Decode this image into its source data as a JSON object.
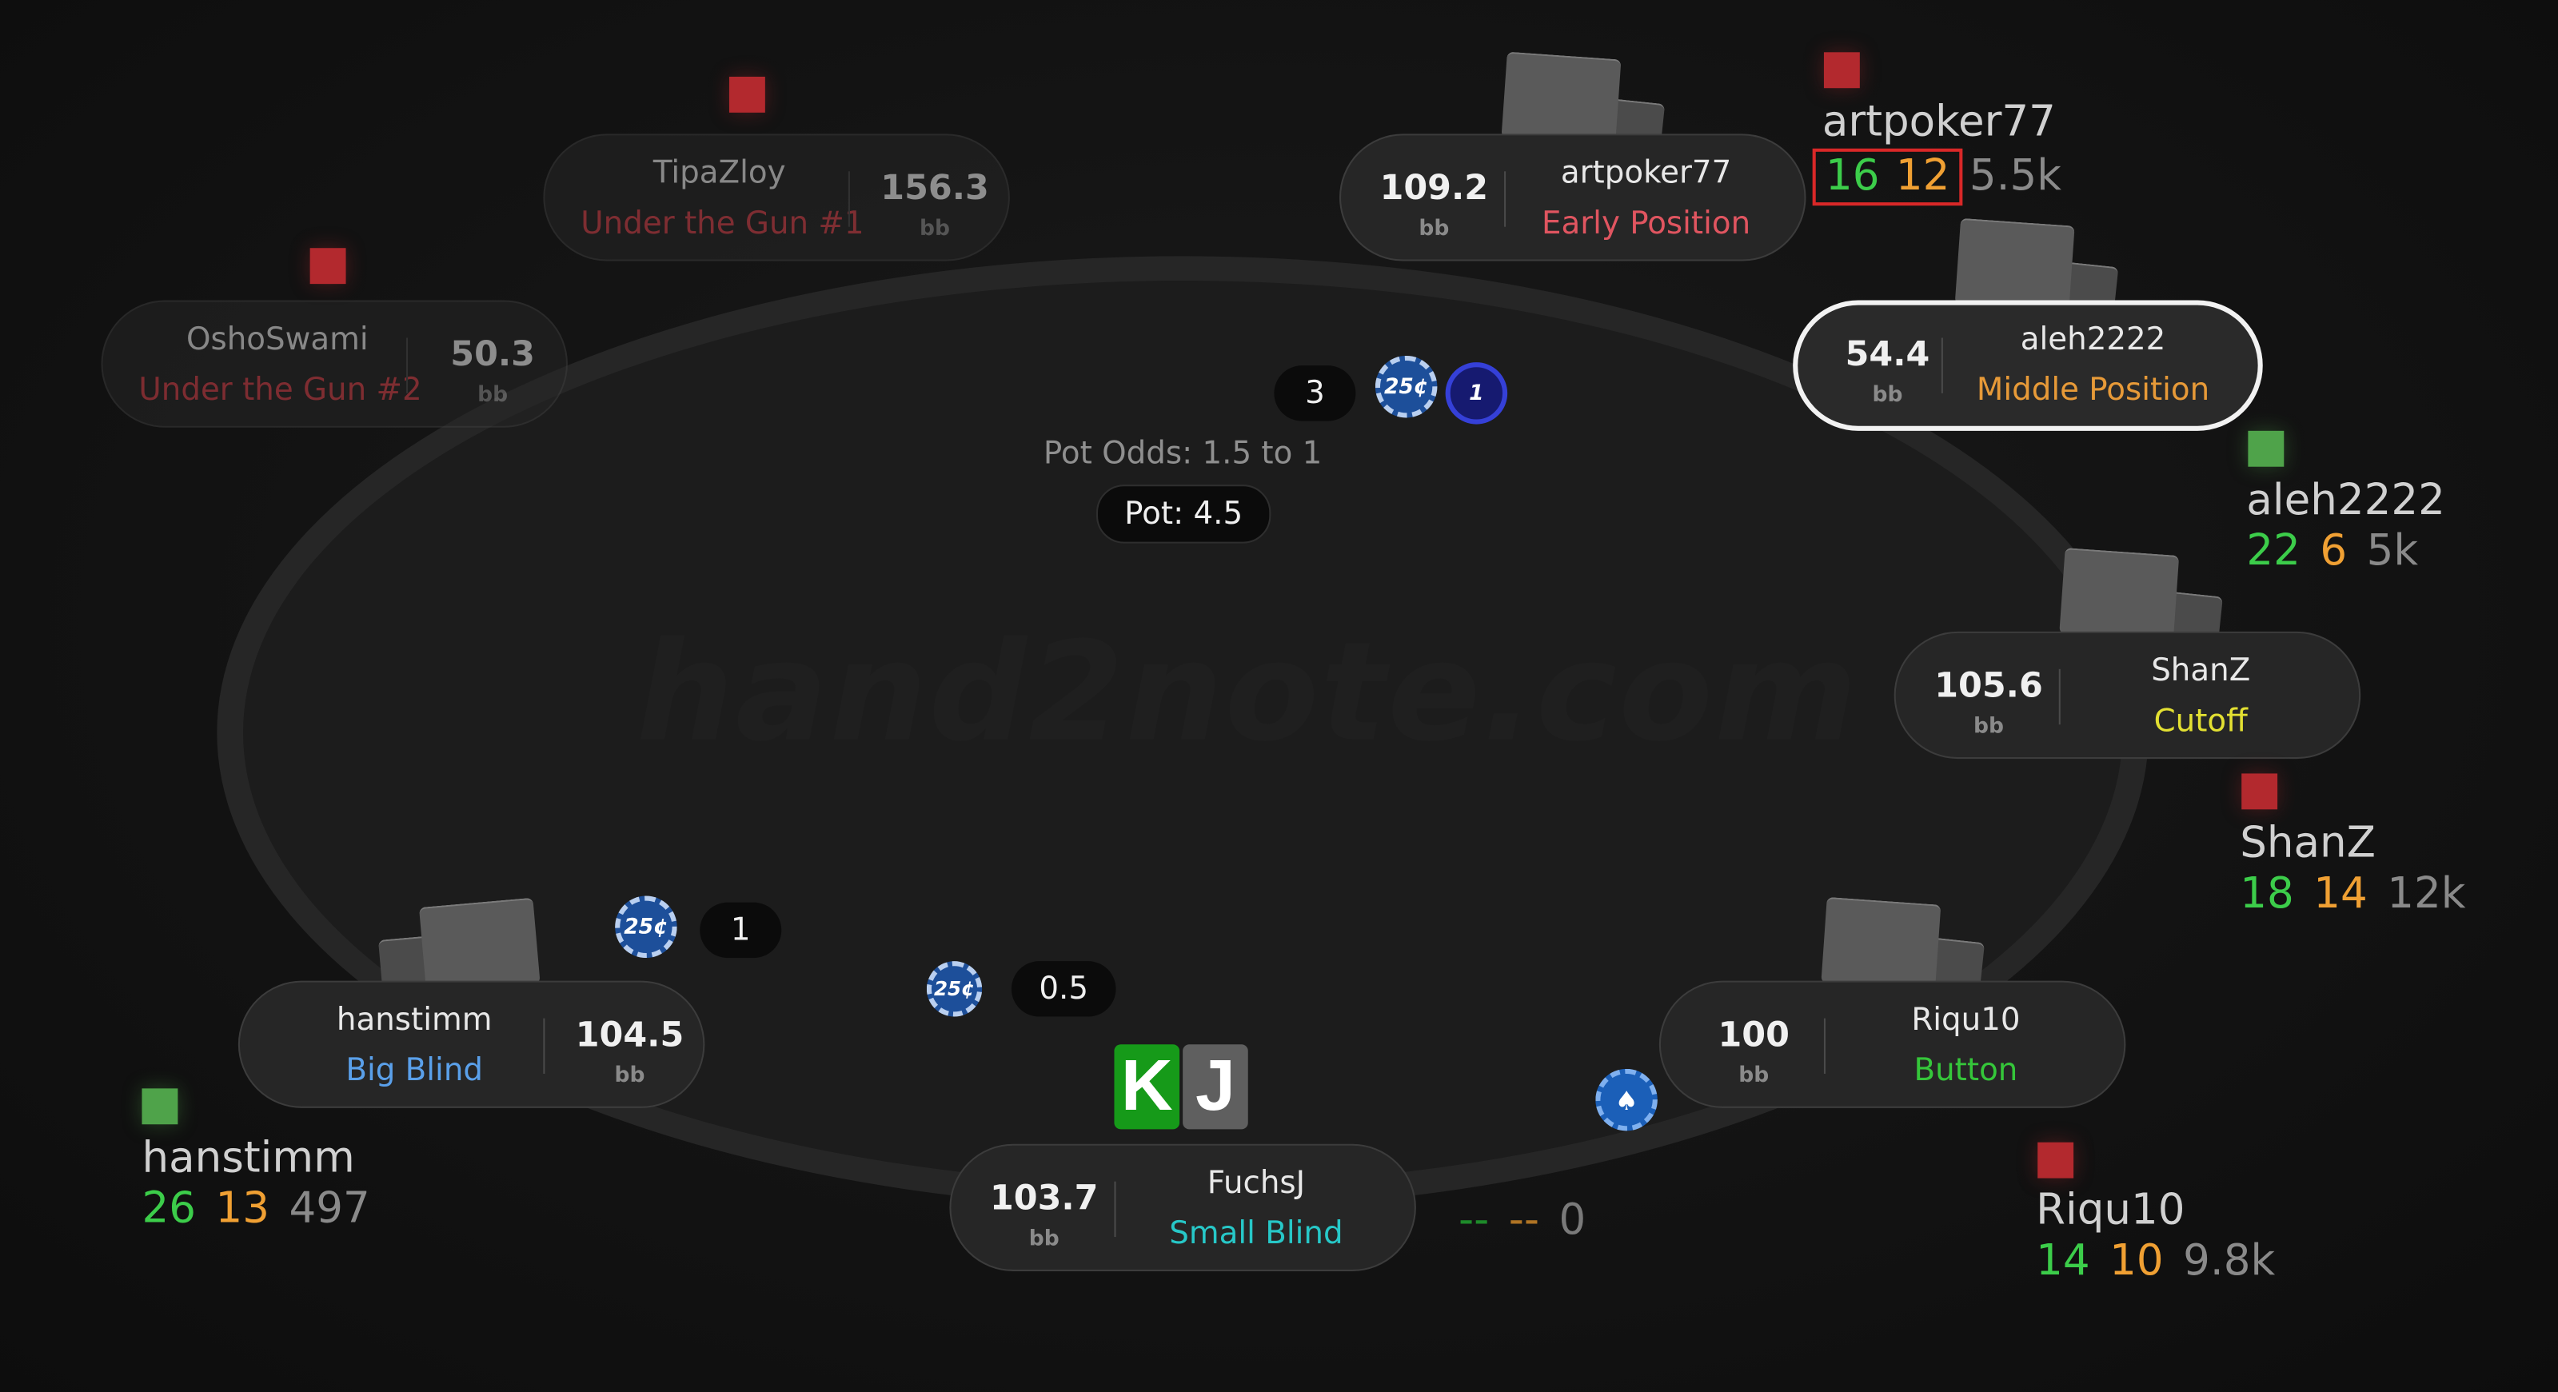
{
  "watermark": "hand2note.com",
  "pot": {
    "odds": "Pot Odds: 1.5 to 1",
    "label": "Pot: 4.5"
  },
  "bets": {
    "utg2_amount": "3",
    "bb_amount": "1",
    "sb_amount": "0.5",
    "chip_label": "25¢",
    "navy_chip_label": "1",
    "dealer_chip_label": "♠"
  },
  "seats": [
    {
      "key": "tipazloy",
      "name": "TipaZloy",
      "position": "Under the Gun #1",
      "stack": "156.3",
      "unit": "bb",
      "position_color": "#d6434b"
    },
    {
      "key": "oshoswami",
      "name": "OshoSwami",
      "position": "Under the Gun #2",
      "stack": "50.3",
      "unit": "bb",
      "position_color": "#d6434b"
    },
    {
      "key": "artpoker77",
      "name": "artpoker77",
      "position": "Early Position",
      "stack": "109.2",
      "unit": "bb",
      "position_color": "#e05560"
    },
    {
      "key": "aleh2222",
      "name": "aleh2222",
      "position": "Middle Position",
      "stack": "54.4",
      "unit": "bb",
      "position_color": "#e79a38"
    },
    {
      "key": "shanz",
      "name": "ShanZ",
      "position": "Cutoff",
      "stack": "105.6",
      "unit": "bb",
      "position_color": "#e3e032"
    },
    {
      "key": "riqu10",
      "name": "Riqu10",
      "position": "Button",
      "stack": "100",
      "unit": "bb",
      "position_color": "#35c63a"
    },
    {
      "key": "fuchsj",
      "name": "FuchsJ",
      "position": "Small Blind",
      "stack": "103.7",
      "unit": "bb",
      "position_color": "#27c8c8"
    },
    {
      "key": "hanstimm",
      "name": "hanstimm",
      "position": "Big Blind",
      "stack": "104.5",
      "unit": "bb",
      "position_color": "#5aa0ea"
    }
  ],
  "huds": {
    "artpoker77": {
      "name": "artpoker77",
      "vpip": "16",
      "pfr": "12",
      "hands": "5.5k",
      "marker": "red"
    },
    "aleh2222": {
      "name": "aleh2222",
      "vpip": "22",
      "pfr": "6",
      "hands": "5k",
      "marker": "green"
    },
    "shanz": {
      "name": "ShanZ",
      "vpip": "18",
      "pfr": "14",
      "hands": "12k",
      "marker": "red"
    },
    "riqu10": {
      "name": "Riqu10",
      "vpip": "14",
      "pfr": "10",
      "hands": "9.8k",
      "marker": "red"
    },
    "hanstimm": {
      "name": "hanstimm",
      "vpip": "26",
      "pfr": "13",
      "hands": "497",
      "marker": "green"
    },
    "hero": {
      "vpip": "--",
      "pfr": "--",
      "hands": "0"
    }
  },
  "hero_cards": [
    "K",
    "J"
  ],
  "colors": {
    "red_marker": "#b3292e",
    "green_marker": "#4fa34a",
    "vpip": "#3ccd4a",
    "pfr": "#f0a033",
    "hands": "#8a8a8a",
    "hud_highlight": "#d92828"
  }
}
